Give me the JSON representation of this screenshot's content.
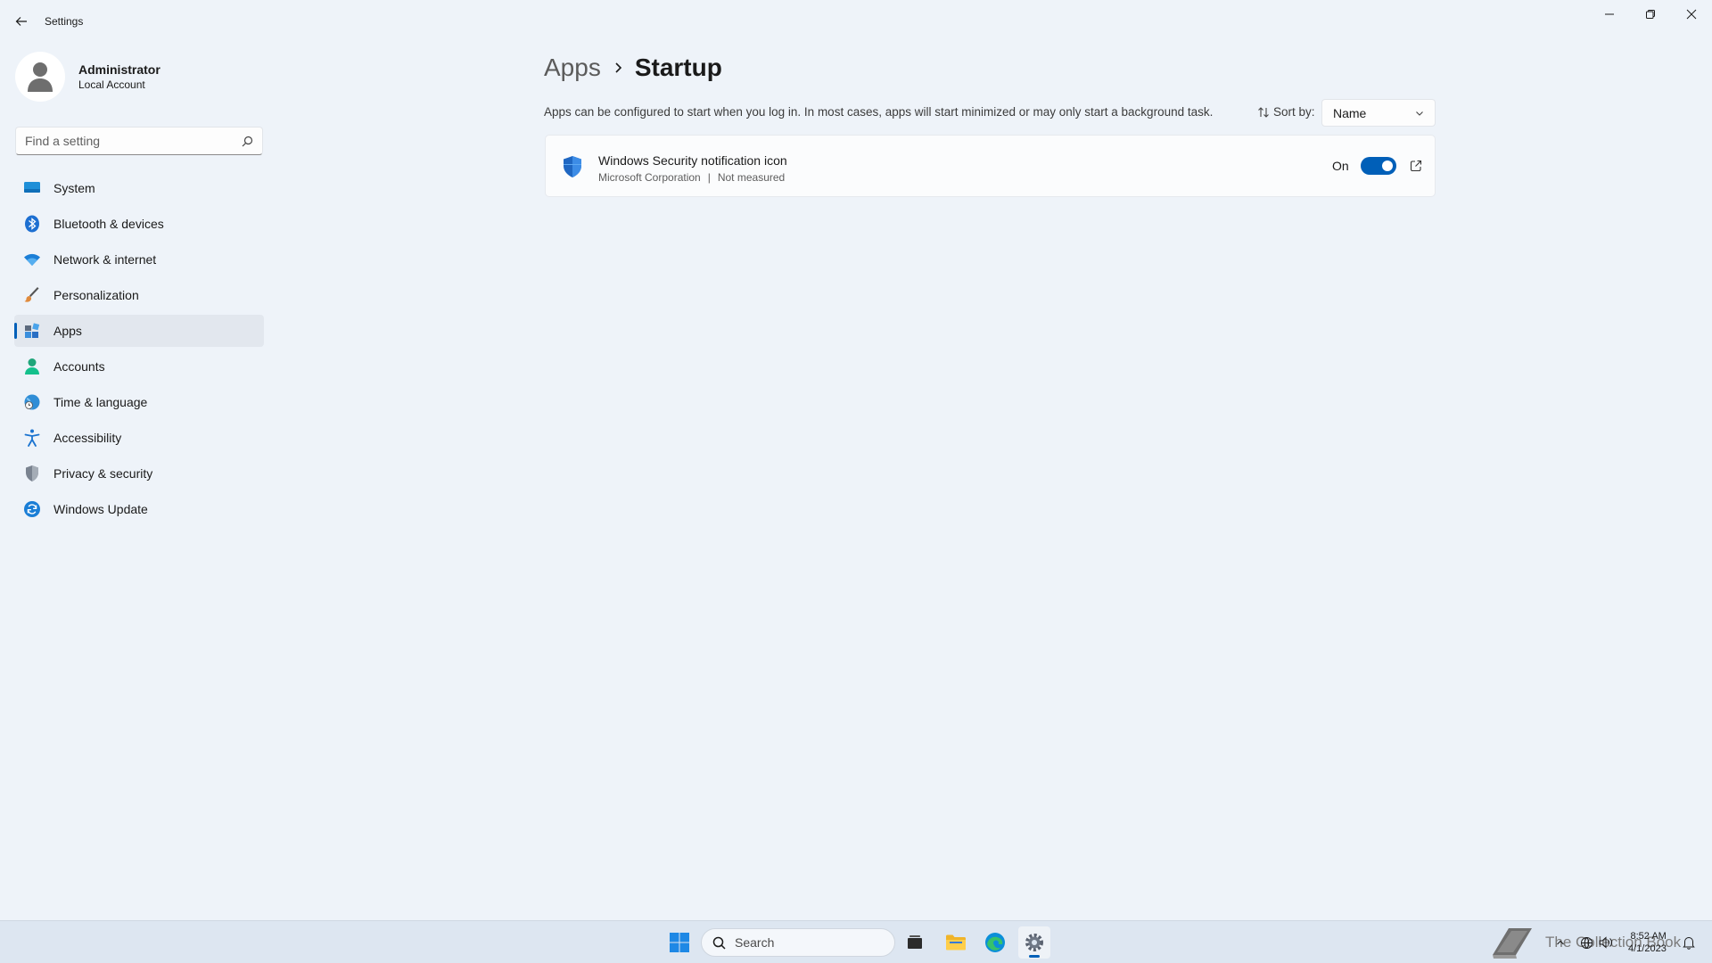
{
  "window": {
    "title": "Settings"
  },
  "profile": {
    "name": "Administrator",
    "account_type": "Local Account"
  },
  "search": {
    "placeholder": "Find a setting"
  },
  "nav": {
    "items": [
      {
        "label": "System",
        "icon": "system-icon"
      },
      {
        "label": "Bluetooth & devices",
        "icon": "bluetooth-icon"
      },
      {
        "label": "Network & internet",
        "icon": "wifi-icon"
      },
      {
        "label": "Personalization",
        "icon": "brush-icon"
      },
      {
        "label": "Apps",
        "icon": "apps-icon",
        "active": true
      },
      {
        "label": "Accounts",
        "icon": "person-icon"
      },
      {
        "label": "Time & language",
        "icon": "globe-clock-icon"
      },
      {
        "label": "Accessibility",
        "icon": "accessibility-icon"
      },
      {
        "label": "Privacy & security",
        "icon": "shield-icon"
      },
      {
        "label": "Windows Update",
        "icon": "update-icon"
      }
    ]
  },
  "breadcrumb": {
    "parent": "Apps",
    "current": "Startup"
  },
  "main": {
    "description": "Apps can be configured to start when you log in. In most cases, apps will start minimized or may only start a background task.",
    "sort_label": "Sort by:",
    "sort_value": "Name"
  },
  "startup_apps": [
    {
      "name": "Windows Security notification icon",
      "publisher": "Microsoft Corporation",
      "impact": "Not measured",
      "state_label": "On",
      "enabled": true
    }
  ],
  "taskbar": {
    "search_label": "Search",
    "watermark": "The Collection Book",
    "time": "8:52 AM",
    "date": "4/1/2023"
  },
  "colors": {
    "accent": "#005fb8",
    "background": "#eef3f9"
  }
}
